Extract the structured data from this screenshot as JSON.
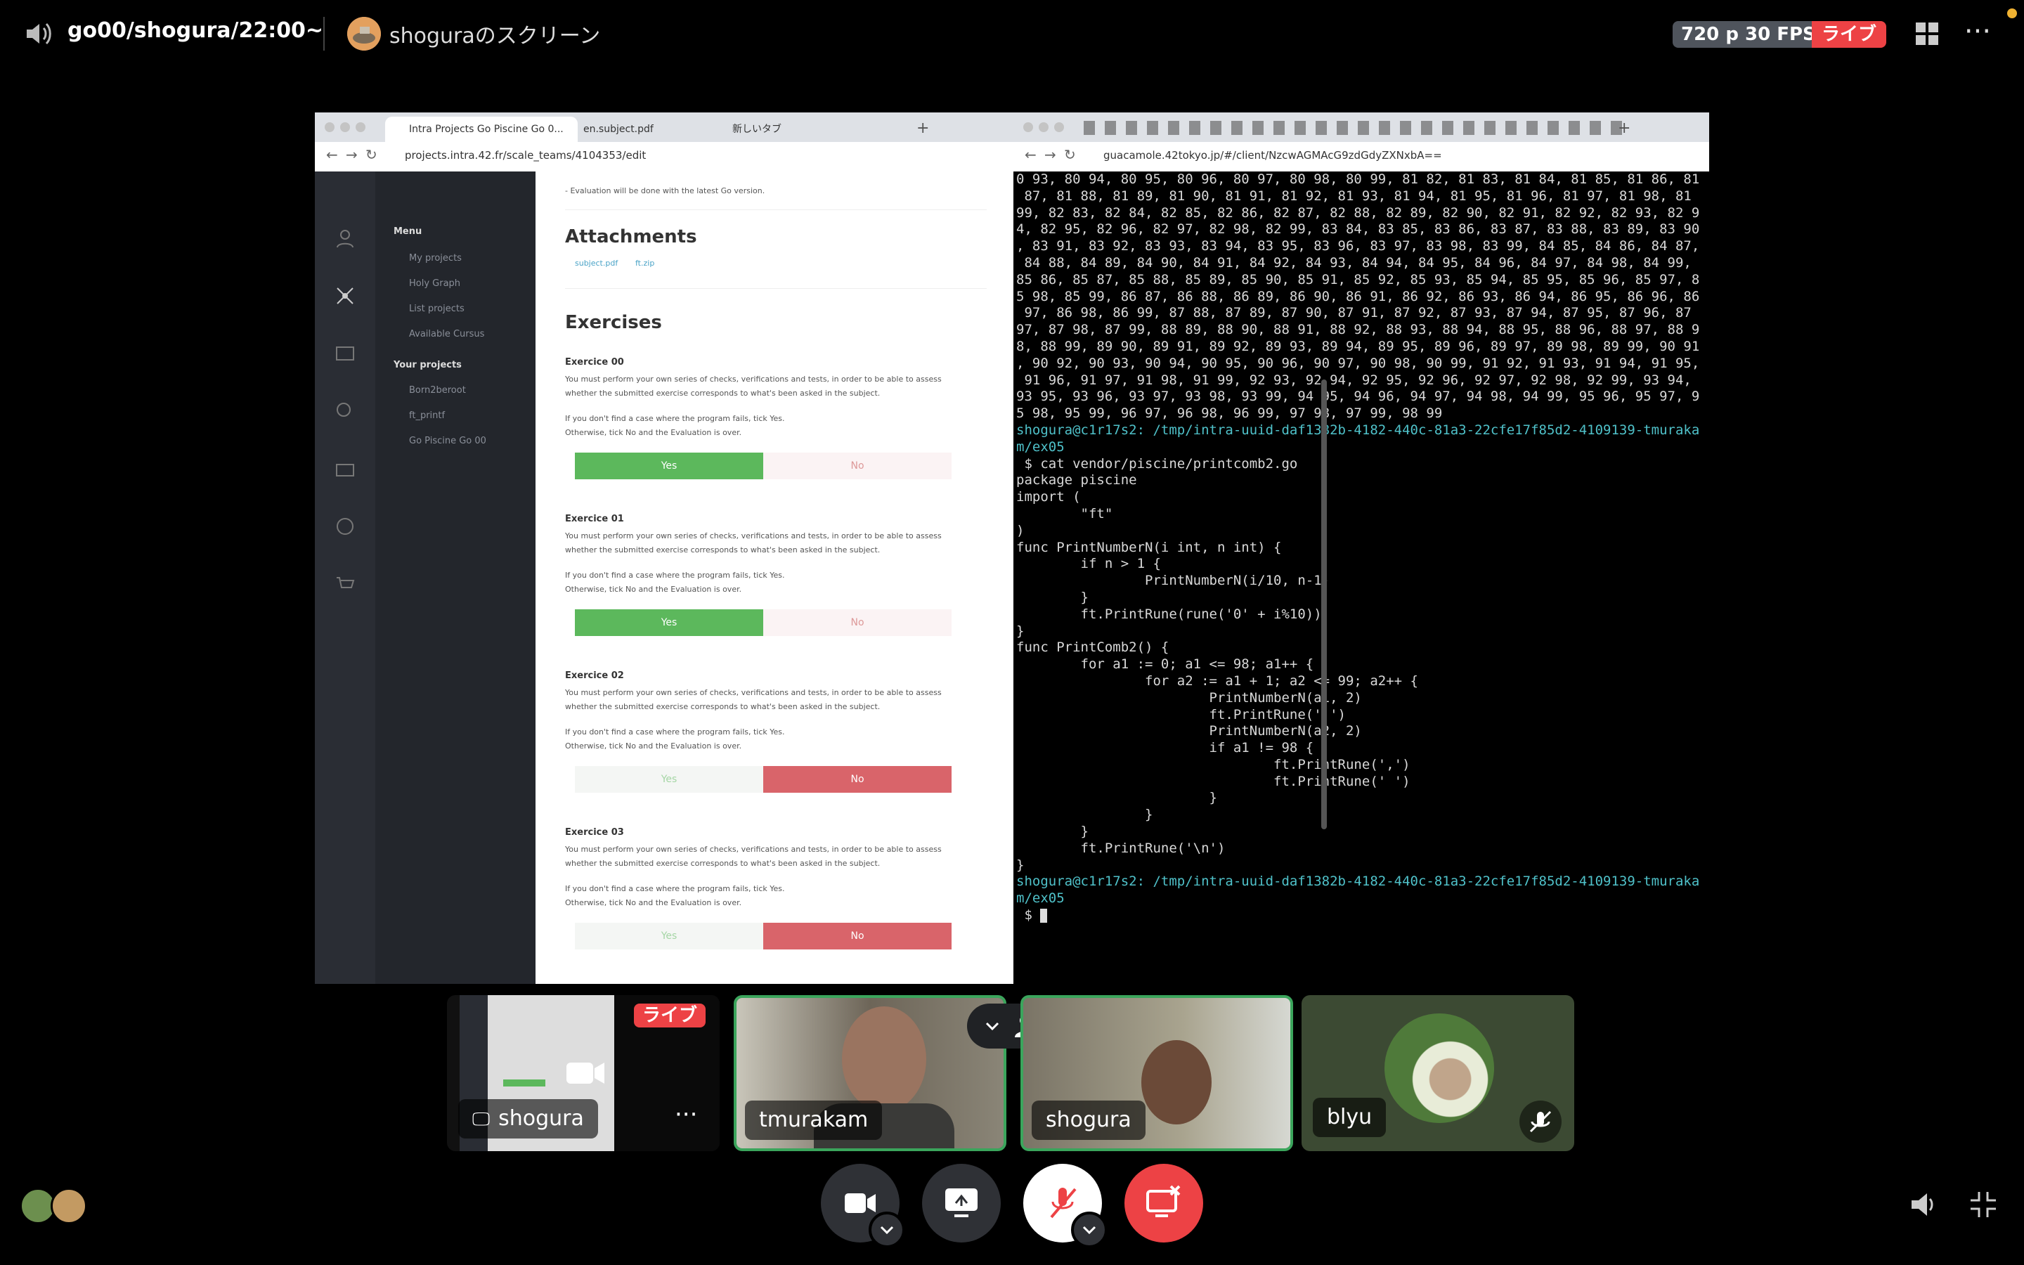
{
  "topbar": {
    "channel_title": "go00/shogura/22:00~",
    "stream_title": "shoguraのスクリーン",
    "quality": "720 p 30 FPS",
    "live": "ライブ"
  },
  "left_browser": {
    "tabs": [
      {
        "label": "Intra Projects Go Piscine Go 0..."
      },
      {
        "label": "en.subject.pdf"
      },
      {
        "label": "新しいタブ"
      }
    ],
    "url": "projects.intra.42.fr/scale_teams/4104353/edit",
    "intra": {
      "note": "- Evaluation will be done with the latest Go version.",
      "menu_heading": "Menu",
      "menu_items": [
        "My projects",
        "Holy Graph",
        "List projects",
        "Available Cursus"
      ],
      "your_projects_heading": "Your projects",
      "projects": [
        "Born2beroot",
        "ft_printf",
        "Go Piscine Go 00"
      ],
      "attachments_title": "Attachments",
      "attachments": [
        "subject.pdf",
        "ft.zip"
      ],
      "exercises_title": "Exercises",
      "exercises": [
        {
          "title": "Exercice 00",
          "text1": "You must perform your own series of checks, verifications and tests, in order to be able to assess whether the submitted exercise corresponds to what's been asked in the subject.",
          "text2": "If you don't find a case where the program fails, tick Yes.",
          "text3": "Otherwise, tick No and the Evaluation is over.",
          "yes": "Yes",
          "no": "No",
          "selected": "yes"
        },
        {
          "title": "Exercice 01",
          "text1": "You must perform your own series of checks, verifications and tests, in order to be able to assess whether the submitted exercise corresponds to what's been asked in the subject.",
          "text2": "If you don't find a case where the program fails, tick Yes.",
          "text3": "Otherwise, tick No and the Evaluation is over.",
          "yes": "Yes",
          "no": "No",
          "selected": "yes"
        },
        {
          "title": "Exercice 02",
          "text1": "You must perform your own series of checks, verifications and tests, in order to be able to assess whether the submitted exercise corresponds to what's been asked in the subject.",
          "text2": "If you don't find a case where the program fails, tick Yes.",
          "text3": "Otherwise, tick No and the Evaluation is over.",
          "yes": "Yes",
          "no": "No",
          "selected": "no"
        },
        {
          "title": "Exercice 03",
          "text1": "You must perform your own series of checks, verifications and tests, in order to be able to assess whether the submitted exercise corresponds to what's been asked in the subject.",
          "text2": "If you don't find a case where the program fails, tick Yes.",
          "text3": "Otherwise, tick No and the Evaluation is over.",
          "yes": "Yes",
          "no": "No",
          "selected": "no"
        }
      ]
    }
  },
  "right_browser": {
    "url": "guacamole.42tokyo.jp/#/client/NzcwAGMAcG9zdGdyZXNxbA==",
    "terminal_lines": [
      "0 93, 80 94, 80 95, 80 96, 80 97, 80 98, 80 99, 81 82, 81 83, 81 84, 81 85, 81 86, 81",
      " 87, 81 88, 81 89, 81 90, 81 91, 81 92, 81 93, 81 94, 81 95, 81 96, 81 97, 81 98, 81",
      "99, 82 83, 82 84, 82 85, 82 86, 82 87, 82 88, 82 89, 82 90, 82 91, 82 92, 82 93, 82 9",
      "4, 82 95, 82 96, 82 97, 82 98, 82 99, 83 84, 83 85, 83 86, 83 87, 83 88, 83 89, 83 90",
      ", 83 91, 83 92, 83 93, 83 94, 83 95, 83 96, 83 97, 83 98, 83 99, 84 85, 84 86, 84 87,",
      " 84 88, 84 89, 84 90, 84 91, 84 92, 84 93, 84 94, 84 95, 84 96, 84 97, 84 98, 84 99,",
      "85 86, 85 87, 85 88, 85 89, 85 90, 85 91, 85 92, 85 93, 85 94, 85 95, 85 96, 85 97, 8",
      "5 98, 85 99, 86 87, 86 88, 86 89, 86 90, 86 91, 86 92, 86 93, 86 94, 86 95, 86 96, 86",
      " 97, 86 98, 86 99, 87 88, 87 89, 87 90, 87 91, 87 92, 87 93, 87 94, 87 95, 87 96, 87",
      "97, 87 98, 87 99, 88 89, 88 90, 88 91, 88 92, 88 93, 88 94, 88 95, 88 96, 88 97, 88 9",
      "8, 88 99, 89 90, 89 91, 89 92, 89 93, 89 94, 89 95, 89 96, 89 97, 89 98, 89 99, 90 91",
      ", 90 92, 90 93, 90 94, 90 95, 90 96, 90 97, 90 98, 90 99, 91 92, 91 93, 91 94, 91 95,",
      " 91 96, 91 97, 91 98, 91 99, 92 93, 92 94, 92 95, 92 96, 92 97, 92 98, 92 99, 93 94,",
      "93 95, 93 96, 93 97, 93 98, 93 99, 94 95, 94 96, 94 97, 94 98, 94 99, 95 96, 95 97, 9",
      "5 98, 95 99, 96 97, 96 98, 96 99, 97 98, 97 99, 98 99"
    ],
    "prompt1a": "shogura@c1r17s2: /tmp/intra-uuid-daf1382b-4182-440c-81a3-22cfe17f85d2-4109139-tmuraka",
    "prompt1b": "m/ex05",
    "command": " $ cat vendor/piscine/printcomb2.go",
    "code_lines": [
      "package piscine",
      "",
      "import (",
      "        \"ft\"",
      ")",
      "",
      "func PrintNumberN(i int, n int) {",
      "        if n > 1 {",
      "                PrintNumberN(i/10, n-1)",
      "        }",
      "        ft.PrintRune(rune('0' + i%10))",
      "}",
      "",
      "func PrintComb2() {",
      "        for a1 := 0; a1 <= 98; a1++ {",
      "                for a2 := a1 + 1; a2 <= 99; a2++ {",
      "                        PrintNumberN(a1, 2)",
      "                        ft.PrintRune(' ')",
      "                        PrintNumberN(a2, 2)",
      "                        if a1 != 98 {",
      "                                ft.PrintRune(',')",
      "                                ft.PrintRune(' ')",
      "                        }",
      "                }",
      "        }",
      "        ft.PrintRune('\\n')",
      "}"
    ],
    "prompt2a": "shogura@c1r17s2: /tmp/intra-uuid-daf1382b-4182-440c-81a3-22cfe17f85d2-4109139-tmuraka",
    "prompt2b": "m/ex05",
    "prompt2c": " $ "
  },
  "participants": [
    {
      "name": "shogura",
      "live": "ライブ"
    },
    {
      "name": "tmurakam"
    },
    {
      "name": "shogura"
    },
    {
      "name": "blyu"
    }
  ],
  "colors": {
    "accent_green": "#3ba55c",
    "live_red": "#ed4245",
    "yes_green": "#5cb85c",
    "no_red": "#d9646a",
    "prompt_cyan": "#4fc1c9"
  }
}
